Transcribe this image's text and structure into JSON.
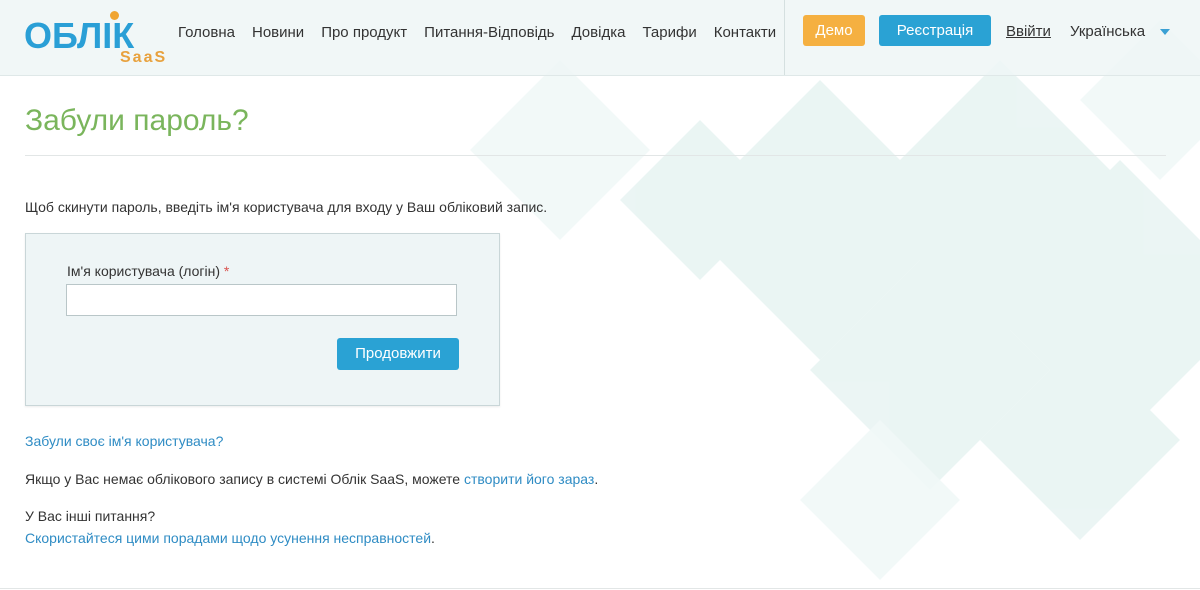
{
  "header": {
    "logo_main": "ОБЛІК",
    "logo_sub": "SaaS",
    "nav": [
      "Головна",
      "Новини",
      "Про продукт",
      "Питання-Відповідь",
      "Довідка",
      "Тарифи",
      "Контакти"
    ],
    "demo_label": "Демо",
    "register_label": "Реєстрація",
    "logout_label": "Ввійти",
    "language": "Українська",
    "colors": {
      "demo": "#f5b041",
      "register": "#2aa2d4",
      "title": "#7ab55c",
      "link": "#2f8cc4"
    }
  },
  "main": {
    "title": "Забули пароль?",
    "intro": "Щоб скинути пароль, введіть ім'я користувача для входу у Ваш обліковий запис.",
    "form": {
      "username_label": "Ім'я користувача (логін)",
      "required_mark": "*",
      "username_value": "",
      "submit_label": "Продовжити"
    },
    "forgot_username_link": "Забули своє ім'я користувача?",
    "no_account_text": "Якщо у Вас немає облікового запису в системі Облік SaaS, можете ",
    "create_link": "створити його зараз",
    "create_suffix": ".",
    "other_questions": "У Вас інші питання?",
    "tips_link": "Скористайтеся цими порадами щодо усунення несправностей",
    "tips_suffix": "."
  }
}
